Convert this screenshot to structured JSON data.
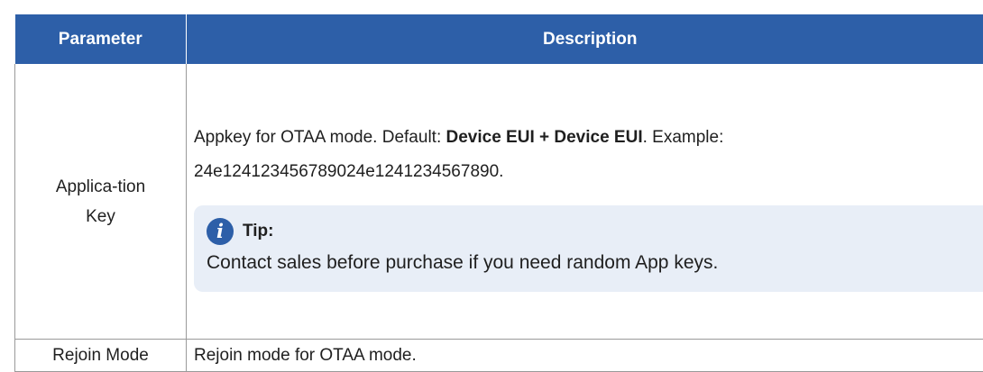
{
  "table": {
    "headers": {
      "parameter": "Parameter",
      "description": "Description"
    },
    "rows": [
      {
        "parameter": "Applica-tion Key",
        "description_lead": "Appkey for OTAA mode. Default: ",
        "description_bold": "Device EUI + Device EUI",
        "description_tail": ". Example: 24e124123456789024e1241234567890.",
        "tip": {
          "title": "Tip:",
          "body": "Contact sales before purchase if you need random App keys."
        }
      },
      {
        "parameter": "Rejoin Mode",
        "description": "Rejoin mode for OTAA mode."
      }
    ]
  },
  "icons": {
    "tip_icon": "info-icon"
  },
  "colors": {
    "header_bg": "#2d5fa8",
    "tip_bg": "#e8eef7"
  }
}
